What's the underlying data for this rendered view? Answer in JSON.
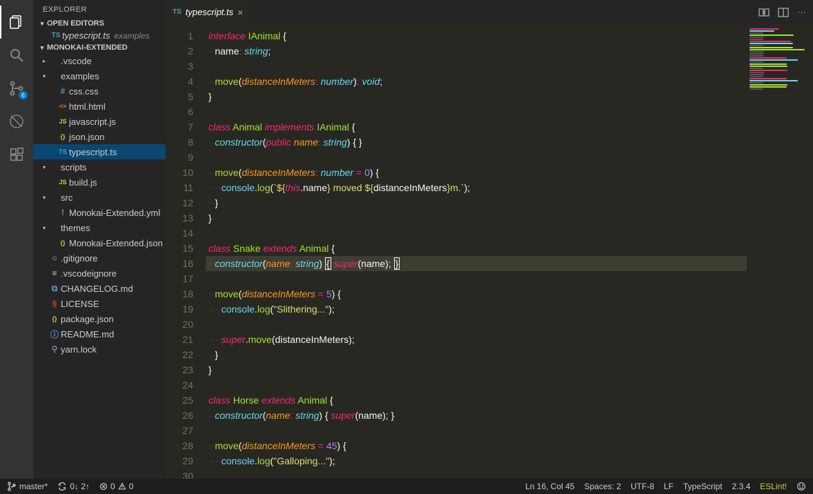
{
  "sidebar": {
    "title": "EXPLORER",
    "openEditorsLabel": "OPEN EDITORS",
    "openEditor": {
      "name": "typescript.ts",
      "desc": "examples"
    },
    "folderLabel": "MONOKAI-EXTENDED",
    "tree": [
      {
        "type": "folder",
        "name": ".vscode",
        "indent": 0,
        "open": false
      },
      {
        "type": "folder",
        "name": "examples",
        "indent": 0,
        "open": true
      },
      {
        "type": "file",
        "name": "css.css",
        "indent": 1,
        "icon": "#",
        "cls": "ic-css"
      },
      {
        "type": "file",
        "name": "html.html",
        "indent": 1,
        "icon": "<>",
        "cls": "ic-html"
      },
      {
        "type": "file",
        "name": "javascript.js",
        "indent": 1,
        "icon": "JS",
        "cls": "ic-js"
      },
      {
        "type": "file",
        "name": "json.json",
        "indent": 1,
        "icon": "{}",
        "cls": "ic-json"
      },
      {
        "type": "file",
        "name": "typescript.ts",
        "indent": 1,
        "icon": "TS",
        "cls": "ic-ts",
        "selected": true
      },
      {
        "type": "folder",
        "name": "scripts",
        "indent": 0,
        "open": true
      },
      {
        "type": "file",
        "name": "build.js",
        "indent": 1,
        "icon": "JS",
        "cls": "ic-js"
      },
      {
        "type": "folder",
        "name": "src",
        "indent": 0,
        "open": true
      },
      {
        "type": "file",
        "name": "Monokai-Extended.yml",
        "indent": 1,
        "icon": "!",
        "cls": "ic-yml"
      },
      {
        "type": "folder",
        "name": "themes",
        "indent": 0,
        "open": true
      },
      {
        "type": "file",
        "name": "Monokai-Extended.json",
        "indent": 1,
        "icon": "{}",
        "cls": "ic-json"
      },
      {
        "type": "file",
        "name": ".gitignore",
        "indent": 0,
        "icon": "○",
        "cls": "ic-git"
      },
      {
        "type": "file",
        "name": ".vscodeignore",
        "indent": 0,
        "icon": "≡",
        "cls": "ic-git"
      },
      {
        "type": "file",
        "name": "CHANGELOG.md",
        "indent": 0,
        "icon": "⧉",
        "cls": "ic-md"
      },
      {
        "type": "file",
        "name": "LICENSE",
        "indent": 0,
        "icon": "§",
        "cls": "ic-lic"
      },
      {
        "type": "file",
        "name": "package.json",
        "indent": 0,
        "icon": "{}",
        "cls": "ic-json"
      },
      {
        "type": "file",
        "name": "README.md",
        "indent": 0,
        "icon": "ⓘ",
        "cls": "ic-info"
      },
      {
        "type": "file",
        "name": "yarn.lock",
        "indent": 0,
        "icon": "⚲",
        "cls": "ic-lock"
      }
    ]
  },
  "scm_badge": "6",
  "tab": {
    "name": "typescript.ts"
  },
  "code": [
    [
      [
        "kw",
        "interface"
      ],
      [
        "pun",
        " "
      ],
      [
        "cls",
        "IAnimal"
      ],
      [
        "pun",
        " {"
      ]
    ],
    [
      [
        "pun",
        "  "
      ],
      [
        "var",
        "name"
      ],
      [
        "op",
        ":"
      ],
      [
        "pun",
        " "
      ],
      [
        "typ",
        "string"
      ],
      [
        "pun",
        ";"
      ]
    ],
    [],
    [
      [
        "pun",
        "  "
      ],
      [
        "fn",
        "move"
      ],
      [
        "pun",
        "("
      ],
      [
        "par",
        "distanceInMeters"
      ],
      [
        "op",
        ":"
      ],
      [
        "pun",
        " "
      ],
      [
        "typ",
        "number"
      ],
      [
        "pun",
        ")"
      ],
      [
        "op",
        ":"
      ],
      [
        "pun",
        " "
      ],
      [
        "typ",
        "void"
      ],
      [
        "pun",
        ";"
      ]
    ],
    [
      [
        "pun",
        "}"
      ]
    ],
    [],
    [
      [
        "kw",
        "class"
      ],
      [
        "pun",
        " "
      ],
      [
        "cls",
        "Animal"
      ],
      [
        "pun",
        " "
      ],
      [
        "kw",
        "implements"
      ],
      [
        "pun",
        " "
      ],
      [
        "cls",
        "IAnimal"
      ],
      [
        "pun",
        " {"
      ]
    ],
    [
      [
        "pun",
        "  "
      ],
      [
        "typ",
        "constructor"
      ],
      [
        "pun",
        "("
      ],
      [
        "kw",
        "public"
      ],
      [
        "pun",
        " "
      ],
      [
        "par",
        "name"
      ],
      [
        "op",
        ":"
      ],
      [
        "pun",
        " "
      ],
      [
        "typ",
        "string"
      ],
      [
        "pun",
        ") { }"
      ]
    ],
    [],
    [
      [
        "pun",
        "  "
      ],
      [
        "fn",
        "move"
      ],
      [
        "pun",
        "("
      ],
      [
        "par",
        "distanceInMeters"
      ],
      [
        "op",
        ":"
      ],
      [
        "pun",
        " "
      ],
      [
        "typ",
        "number"
      ],
      [
        "pun",
        " "
      ],
      [
        "op",
        "="
      ],
      [
        "pun",
        " "
      ],
      [
        "num",
        "0"
      ],
      [
        "pun",
        ") {"
      ]
    ],
    [
      [
        "pun",
        "    "
      ],
      [
        "prop",
        "console"
      ],
      [
        "pun",
        "."
      ],
      [
        "fn",
        "log"
      ],
      [
        "pun",
        "("
      ],
      [
        "str",
        "`${"
      ],
      [
        "kw",
        "this"
      ],
      [
        "pun",
        "."
      ],
      [
        "var",
        "name"
      ],
      [
        "str",
        "} moved ${"
      ],
      [
        "var",
        "distanceInMeters"
      ],
      [
        "str",
        "}m.`"
      ],
      [
        "pun",
        ");"
      ]
    ],
    [
      [
        "pun",
        "  }"
      ]
    ],
    [
      [
        "pun",
        "}"
      ]
    ],
    [],
    [
      [
        "kw",
        "class"
      ],
      [
        "pun",
        " "
      ],
      [
        "cls",
        "Snake"
      ],
      [
        "pun",
        " "
      ],
      [
        "kw",
        "extends"
      ],
      [
        "pun",
        " "
      ],
      [
        "cls",
        "Animal"
      ],
      [
        "pun",
        " {"
      ]
    ],
    [
      [
        "pun",
        "  "
      ],
      [
        "typ",
        "constructor"
      ],
      [
        "pun",
        "("
      ],
      [
        "par",
        "name"
      ],
      [
        "op",
        ":"
      ],
      [
        "pun",
        " "
      ],
      [
        "typ",
        "string"
      ],
      [
        "pun",
        ") "
      ],
      [
        "cursor",
        "{"
      ],
      [
        "pun",
        " "
      ],
      [
        "kw",
        "super"
      ],
      [
        "pun",
        "(name); "
      ],
      [
        "cursor",
        "}"
      ]
    ],
    [],
    [
      [
        "pun",
        "  "
      ],
      [
        "fn",
        "move"
      ],
      [
        "pun",
        "("
      ],
      [
        "par",
        "distanceInMeters"
      ],
      [
        "pun",
        " "
      ],
      [
        "op",
        "="
      ],
      [
        "pun",
        " "
      ],
      [
        "num",
        "5"
      ],
      [
        "pun",
        ") {"
      ]
    ],
    [
      [
        "pun",
        "    "
      ],
      [
        "prop",
        "console"
      ],
      [
        "pun",
        "."
      ],
      [
        "fn",
        "log"
      ],
      [
        "pun",
        "("
      ],
      [
        "str",
        "\"Slithering...\""
      ],
      [
        "pun",
        ");"
      ]
    ],
    [],
    [
      [
        "pun",
        "    "
      ],
      [
        "kw",
        "super"
      ],
      [
        "pun",
        "."
      ],
      [
        "fn",
        "move"
      ],
      [
        "pun",
        "(distanceInMeters);"
      ]
    ],
    [
      [
        "pun",
        "  }"
      ]
    ],
    [
      [
        "pun",
        "}"
      ]
    ],
    [],
    [
      [
        "kw",
        "class"
      ],
      [
        "pun",
        " "
      ],
      [
        "cls",
        "Horse"
      ],
      [
        "pun",
        " "
      ],
      [
        "kw",
        "extends"
      ],
      [
        "pun",
        " "
      ],
      [
        "cls",
        "Animal"
      ],
      [
        "pun",
        " {"
      ]
    ],
    [
      [
        "pun",
        "  "
      ],
      [
        "typ",
        "constructor"
      ],
      [
        "pun",
        "("
      ],
      [
        "par",
        "name"
      ],
      [
        "op",
        ":"
      ],
      [
        "pun",
        " "
      ],
      [
        "typ",
        "string"
      ],
      [
        "pun",
        ") { "
      ],
      [
        "kw",
        "super"
      ],
      [
        "pun",
        "(name); }"
      ]
    ],
    [],
    [
      [
        "pun",
        "  "
      ],
      [
        "fn",
        "move"
      ],
      [
        "pun",
        "("
      ],
      [
        "par",
        "distanceInMeters"
      ],
      [
        "pun",
        " "
      ],
      [
        "op",
        "="
      ],
      [
        "pun",
        " "
      ],
      [
        "num",
        "45"
      ],
      [
        "pun",
        ") {"
      ]
    ],
    [
      [
        "pun",
        "    "
      ],
      [
        "prop",
        "console"
      ],
      [
        "pun",
        "."
      ],
      [
        "fn",
        "log"
      ],
      [
        "pun",
        "("
      ],
      [
        "str",
        "\"Galloping...\""
      ],
      [
        "pun",
        ");"
      ]
    ],
    []
  ],
  "currentLine": 16,
  "status": {
    "branch": "master*",
    "sync": "0↓ 2↑",
    "problems": "0  0",
    "lnCol": "Ln 16, Col 45",
    "spaces": "Spaces: 2",
    "encoding": "UTF-8",
    "eol": "LF",
    "lang": "TypeScript",
    "version": "2.3.4",
    "eslint": "ESLint!"
  }
}
